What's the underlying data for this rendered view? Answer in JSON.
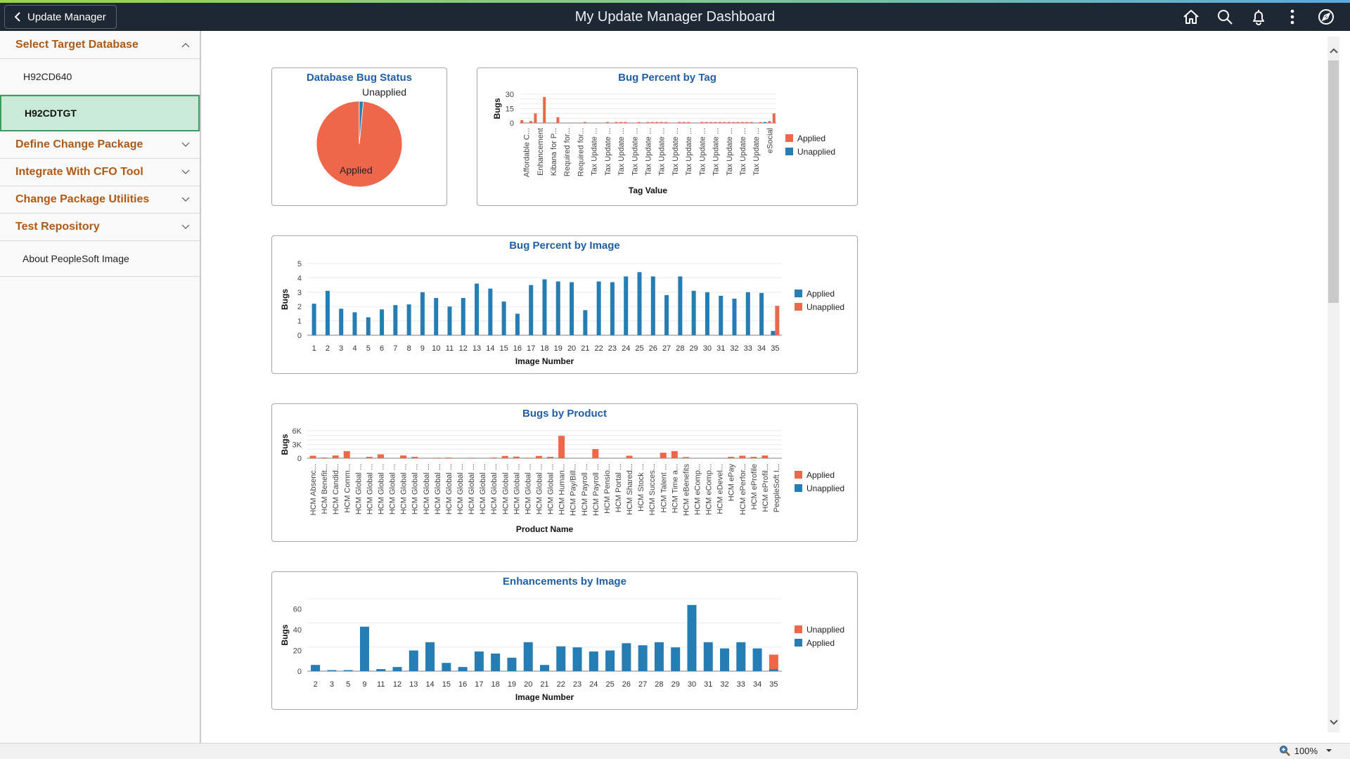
{
  "header": {
    "back_label": "Update Manager",
    "title": "My Update Manager Dashboard",
    "icons": [
      "home-icon",
      "search-icon",
      "notifications-icon",
      "actions-menu-icon",
      "navbar-compass-icon"
    ]
  },
  "sidebar": {
    "sections": [
      {
        "label": "Select Target Database",
        "expanded": true
      },
      {
        "label": "Define Change Package",
        "expanded": false
      },
      {
        "label": "Integrate With CFO Tool",
        "expanded": false
      },
      {
        "label": "Change Package Utilities",
        "expanded": false
      },
      {
        "label": "Test Repository",
        "expanded": false
      }
    ],
    "databases": [
      {
        "label": "H92CD640",
        "selected": false
      },
      {
        "label": "H92CDTGT",
        "selected": true
      }
    ],
    "about_link": "About PeopleSoft Image"
  },
  "colors": {
    "applied_orange": "#ef674a",
    "unapplied_blue": "#267db3",
    "title_blue": "#1f5fa6",
    "section_brown": "#ad5a17",
    "selected_bg": "#c8ead6",
    "header_bg": "#1e2835"
  },
  "statusbar": {
    "zoom": "100%"
  },
  "chart_data": [
    {
      "id": "db-bug-status",
      "type": "pie",
      "title": "Database Bug Status",
      "slices": [
        {
          "label": "Applied",
          "value": 98.5,
          "color": "#ef674a"
        },
        {
          "label": "Unapplied",
          "value": 1.5,
          "color": "#267db3"
        }
      ]
    },
    {
      "id": "bug-percent-by-tag",
      "type": "bar",
      "title": "Bug Percent by Tag",
      "xlabel": "Tag Value",
      "ylabel": "Bugs",
      "ylim": [
        0,
        30
      ],
      "yticks": [
        0,
        15,
        30
      ],
      "grid": true,
      "legend": "right",
      "legend_entries": [
        {
          "name": "Applied",
          "color": "#ef674a"
        },
        {
          "name": "Unapplied",
          "color": "#267db3"
        }
      ],
      "tick_labels": [
        "Affordable C...",
        "Enhancement",
        "Kibana for P...",
        "Required for...",
        "Required for...",
        "Tax Update ...",
        "Tax Update ...",
        "Tax Update ...",
        "Tax Update ...",
        "Tax Update ...",
        "Tax Update ...",
        "Tax Update ...",
        "Tax Update ...",
        "Tax Update ...",
        "Tax Update ...",
        "Tax Update ...",
        "Tax Update ...",
        "Tax Update ...",
        "eSocial"
      ],
      "series": [
        {
          "name": "Applied",
          "values": [
            3,
            0,
            2,
            10,
            0,
            27,
            0,
            0,
            6,
            0,
            0,
            0,
            0,
            0,
            1,
            0,
            0,
            0,
            0,
            1,
            0,
            1,
            1,
            1,
            0,
            0,
            1,
            0,
            1,
            1,
            1,
            1,
            1,
            0,
            0,
            1,
            1,
            1,
            0,
            0,
            1,
            1,
            1,
            1,
            1,
            1,
            1,
            1,
            1,
            1,
            1,
            1,
            0,
            1,
            0,
            2,
            10
          ]
        },
        {
          "name": "Unapplied",
          "values": [
            0,
            0,
            0,
            0,
            0,
            0,
            0,
            0,
            0,
            0,
            0,
            0,
            0,
            0,
            0,
            0,
            0,
            0,
            0,
            0,
            0,
            0,
            0,
            0,
            0,
            0,
            0,
            0,
            0,
            0,
            0,
            0,
            0,
            0,
            0,
            0,
            0,
            0,
            0,
            0,
            0,
            0,
            0,
            0,
            0,
            0,
            0,
            0,
            0,
            0,
            0,
            0,
            0,
            0,
            1,
            0,
            0
          ]
        }
      ]
    },
    {
      "id": "bug-percent-by-image",
      "type": "bar",
      "title": "Bug Percent by Image",
      "xlabel": "Image Number",
      "ylabel": "Bugs",
      "ylim": [
        0,
        5
      ],
      "yticks": [
        0,
        1,
        2,
        3,
        4,
        5
      ],
      "grid": true,
      "legend": "right",
      "legend_entries": [
        {
          "name": "Applied",
          "color": "#267db3"
        },
        {
          "name": "Unapplied",
          "color": "#ef674a"
        }
      ],
      "categories": [
        "1",
        "2",
        "3",
        "4",
        "5",
        "6",
        "7",
        "8",
        "9",
        "10",
        "11",
        "12",
        "13",
        "14",
        "15",
        "16",
        "17",
        "18",
        "19",
        "20",
        "21",
        "22",
        "23",
        "24",
        "25",
        "26",
        "27",
        "28",
        "29",
        "30",
        "31",
        "32",
        "33",
        "34",
        "35"
      ],
      "series": [
        {
          "name": "Applied",
          "values": [
            2.2,
            3.1,
            1.85,
            1.6,
            1.25,
            1.8,
            2.1,
            2.15,
            3.0,
            2.6,
            2.0,
            2.6,
            3.6,
            3.25,
            2.35,
            1.5,
            3.5,
            3.9,
            3.75,
            3.7,
            1.75,
            3.75,
            3.7,
            4.1,
            4.4,
            4.1,
            2.8,
            4.1,
            3.1,
            3.0,
            2.75,
            2.55,
            3.0,
            2.95,
            0.3
          ]
        },
        {
          "name": "Unapplied",
          "values": [
            0,
            0,
            0,
            0,
            0,
            0,
            0,
            0,
            0,
            0,
            0,
            0,
            0,
            0,
            0,
            0,
            0,
            0,
            0,
            0,
            0,
            0,
            0,
            0,
            0,
            0,
            0,
            0,
            0,
            0,
            0,
            0,
            0,
            0,
            2.05
          ]
        }
      ]
    },
    {
      "id": "bugs-by-product",
      "type": "bar",
      "title": "Bugs by Product",
      "xlabel": "Product Name",
      "ylabel": "Bugs",
      "ylim": [
        0,
        6000
      ],
      "yticks": [
        0,
        3000,
        6000
      ],
      "ytick_labels": [
        "0",
        "3K",
        "6K"
      ],
      "grid": true,
      "legend": "right",
      "legend_entries": [
        {
          "name": "Applied",
          "color": "#ef674a"
        },
        {
          "name": "Unapplied",
          "color": "#267db3"
        }
      ],
      "categories": [
        "HCM Absenc...",
        "HCM Benefit...",
        "HCM Candid...",
        "HCM Comm...",
        "HCM Global ...",
        "HCM Global ...",
        "HCM Global ...",
        "HCM Global ...",
        "HCM Global ...",
        "HCM Global ...",
        "HCM Global ...",
        "HCM Global ...",
        "HCM Global ...",
        "HCM Global ...",
        "HCM Global ...",
        "HCM Global ...",
        "HCM Global ...",
        "HCM Global ...",
        "HCM Global ...",
        "HCM Global ...",
        "HCM Global ...",
        "HCM Global ...",
        "HCM Human...",
        "HCM Pay/Bill...",
        "HCM Payroll ...",
        "HCM Payroll ...",
        "HCM Pensio...",
        "HCM Portal ...",
        "HCM Shared...",
        "HCM Stock ...",
        "HCM Succes...",
        "HCM Talent ...",
        "HCM Time a...",
        "HCM eBenefits",
        "HCM eComp...",
        "HCM eComp...",
        "HCM eDevel...",
        "HCM ePay",
        "HCM ePerfor...",
        "HCM eProfile",
        "HCM eProfil...",
        "PeopleSoft I..."
      ],
      "series": [
        {
          "name": "Applied",
          "values": [
            550,
            150,
            600,
            1550,
            0,
            300,
            850,
            0,
            600,
            300,
            0,
            100,
            150,
            0,
            100,
            0,
            150,
            500,
            350,
            100,
            500,
            300,
            4900,
            0,
            0,
            2000,
            0,
            0,
            550,
            0,
            0,
            1200,
            1550,
            250,
            0,
            0,
            0,
            300,
            550,
            300,
            600,
            0
          ]
        },
        {
          "name": "Unapplied",
          "values": [
            0,
            0,
            0,
            0,
            0,
            0,
            0,
            0,
            0,
            0,
            0,
            0,
            0,
            0,
            0,
            0,
            0,
            0,
            0,
            0,
            0,
            0,
            0,
            0,
            0,
            0,
            0,
            0,
            0,
            0,
            0,
            0,
            0,
            0,
            0,
            0,
            0,
            0,
            0,
            0,
            0,
            0
          ]
        }
      ]
    },
    {
      "id": "enhancements-by-image",
      "type": "bar",
      "stacked": true,
      "title": "Enhancements by Image",
      "xlabel": "Image Number",
      "ylabel": "Bugs",
      "ylim": [
        0,
        70
      ],
      "yticks": [
        0,
        20,
        40,
        60
      ],
      "grid": true,
      "legend": "right",
      "legend_entries": [
        {
          "name": "Unapplied",
          "color": "#ef674a"
        },
        {
          "name": "Applied",
          "color": "#267db3"
        }
      ],
      "categories": [
        "2",
        "3",
        "5",
        "9",
        "11",
        "12",
        "13",
        "14",
        "15",
        "16",
        "17",
        "18",
        "19",
        "20",
        "21",
        "22",
        "23",
        "24",
        "25",
        "26",
        "27",
        "28",
        "29",
        "30",
        "31",
        "32",
        "33",
        "34",
        "35"
      ],
      "series": [
        {
          "name": "Applied",
          "values": [
            6,
            1,
            1,
            43,
            2,
            4,
            20,
            28,
            8,
            4,
            19,
            17,
            13,
            28,
            6,
            24,
            23,
            19,
            20,
            27,
            25,
            28,
            23,
            64,
            28,
            22,
            28,
            22,
            2
          ]
        },
        {
          "name": "Unapplied",
          "values": [
            0,
            0,
            0,
            0,
            0,
            0,
            0,
            0,
            0,
            0,
            0,
            0,
            0,
            0,
            0,
            0,
            0,
            0,
            0,
            0,
            0,
            0,
            0,
            0,
            0,
            0,
            0,
            0,
            14
          ]
        }
      ]
    }
  ]
}
